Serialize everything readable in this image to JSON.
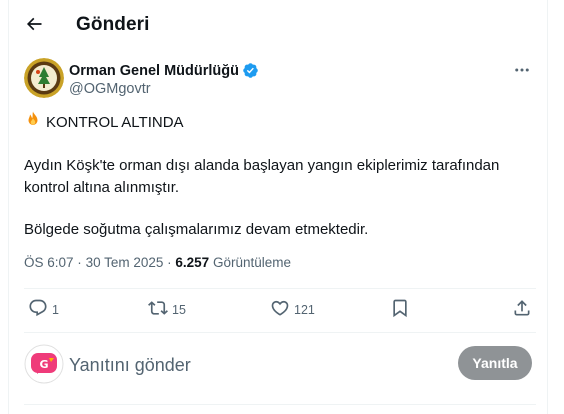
{
  "header": {
    "title": "Gönderi",
    "back_icon": "arrow-left-icon"
  },
  "author": {
    "name": "Orman Genel Müdürlüğü",
    "handle": "@OGMgovtr",
    "verified": true,
    "verified_color": "#1d9bf0",
    "avatar_icon": "ogm-logo",
    "more_icon": "more-horizontal-icon"
  },
  "tweet": {
    "emoji": "fire-emoji",
    "line1": "KONTROL ALTINDA",
    "para1": "Aydın Köşk'te orman dışı alanda başlayan yangın ekiplerimiz tarafından kontrol altına alınmıştır.",
    "para2": "Bölgede soğutma çalışmalarımız devam etmektedir."
  },
  "meta": {
    "time": "ÖS 6:07",
    "separator": "·",
    "date": "30 Tem 2025",
    "views_count": "6.257",
    "views_label": "Görüntüleme"
  },
  "actions": {
    "reply_count": "1",
    "retweet_count": "15",
    "like_count": "121"
  },
  "reply": {
    "placeholder": "Yanıtını gönder",
    "button_label": "Yanıtla",
    "avatar_icon": "user-logo"
  },
  "colors": {
    "text": "#0f1419",
    "secondary": "#536471",
    "button_disabled": "#8f9396",
    "fire": "#f4900c"
  }
}
